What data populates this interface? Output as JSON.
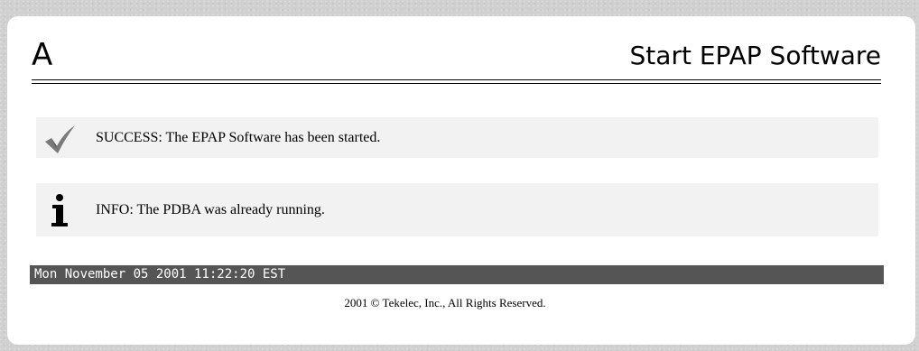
{
  "header": {
    "letter": "A",
    "title": "Start EPAP Software"
  },
  "messages": [
    {
      "type": "success",
      "icon": "checkmark-icon",
      "text": "SUCCESS: The EPAP Software has been started."
    },
    {
      "type": "info",
      "icon": "info-icon",
      "text": "INFO: The PDBA was already running."
    }
  ],
  "status_bar": {
    "datetime": "Mon November 05 2001 11:22:20 EST"
  },
  "footer": {
    "copyright": "2001 © Tekelec, Inc., All Rights Reserved."
  },
  "colors": {
    "page_bg": "#d0d0d0",
    "panel_bg": "#ffffff",
    "message_bg": "#f2f2f2",
    "status_bar_bg": "#555555",
    "checkmark": "#7a7a7a"
  }
}
